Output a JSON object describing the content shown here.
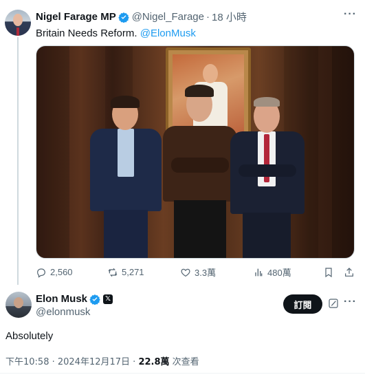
{
  "tweet1": {
    "display_name": "Nigel Farage MP",
    "handle": "@Nigel_Farage",
    "dot": "·",
    "time": "18 小時",
    "text": "Britain Needs Reform.",
    "mention": "@ElonMusk",
    "more": "···",
    "stats": {
      "replies": "2,560",
      "reposts": "5,271",
      "likes": "3.3萬",
      "views": "480萬"
    }
  },
  "tweet2": {
    "display_name": "Elon Musk",
    "handle": "@elonmusk",
    "x_badge": "𝕏",
    "subscribe_label": "訂閱",
    "more": "···",
    "text": "Absolutely",
    "timestamp": "下午10:58 · 2024年12月17日 · ",
    "views_count": "22.8萬",
    "views_label": " 次查看"
  },
  "colors": {
    "accent": "#1d9bf0",
    "text_primary": "#0f1419",
    "text_secondary": "#536471"
  }
}
